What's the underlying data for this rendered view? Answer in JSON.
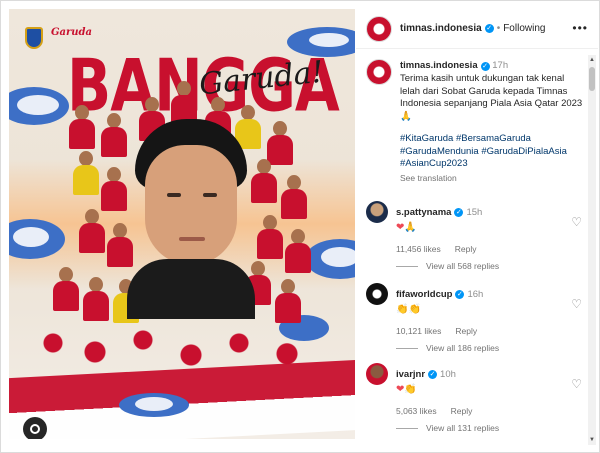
{
  "post": {
    "image": {
      "logo_text": "Garuda",
      "headline": "BANGGA",
      "script_word": "Garuda!"
    }
  },
  "header": {
    "username": "timnas.indonesia",
    "follow_state": "Following",
    "more_icon": "more-horizontal-icon"
  },
  "caption": {
    "username": "timnas.indonesia",
    "time": "17h",
    "text": "Terima kasih untuk dukungan tak kenal lelah dari Sobat Garuda kepada Timnas Indonesia sepanjang Piala Asia Qatar 2023 🙏",
    "hashtags": "#KitaGaruda #BersamaGaruda #GarudaMendunia #GarudaDiPialaAsia #AsianCup2023",
    "see_translation": "See translation"
  },
  "comments": [
    {
      "username": "s.pattynama",
      "time": "15h",
      "emoji": [
        "❤",
        "🙏"
      ],
      "likes": "11,456 likes",
      "reply": "Reply",
      "view_replies": "View all 568 replies"
    },
    {
      "username": "fifaworldcup",
      "time": "16h",
      "emoji": [
        "👏",
        "👏"
      ],
      "likes": "10,121 likes",
      "reply": "Reply",
      "view_replies": "View all 186 replies"
    },
    {
      "username": "ivarjnr",
      "time": "10h",
      "emoji": [
        "❤",
        "👏"
      ],
      "likes": "5,063 likes",
      "reply": "Reply",
      "view_replies": "View all 131 replies"
    }
  ],
  "colors": {
    "accent": "#c8102e",
    "verified": "#0095f6",
    "hashtag": "#00376b"
  }
}
